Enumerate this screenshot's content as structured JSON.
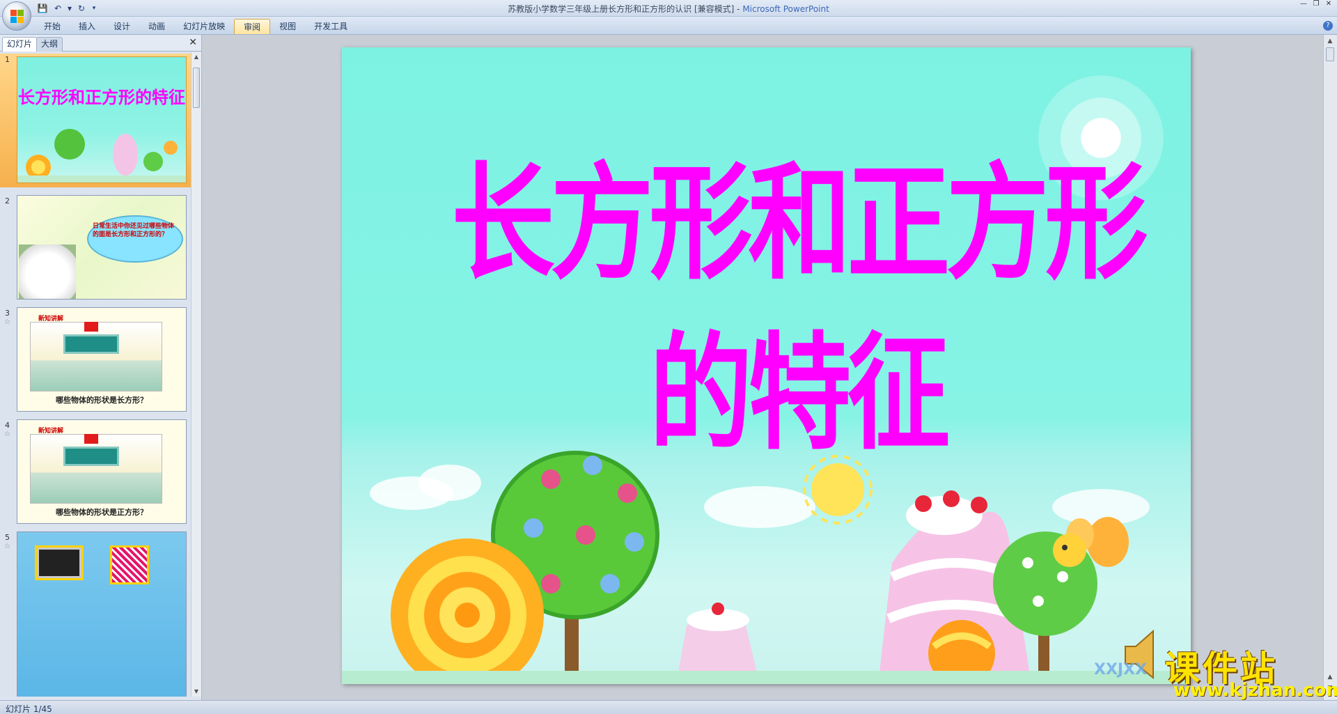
{
  "window": {
    "title": "苏教版小学数学三年级上册长方形和正方形的认识 [兼容模式]",
    "app_name": "Microsoft PowerPoint",
    "title_separator": " - "
  },
  "quick_access": {
    "icons": [
      "save-icon",
      "undo-icon",
      "dropdown-icon",
      "redo-icon",
      "customize-icon"
    ]
  },
  "ribbon": {
    "tabs": [
      {
        "label": "开始"
      },
      {
        "label": "插入"
      },
      {
        "label": "设计"
      },
      {
        "label": "动画"
      },
      {
        "label": "幻灯片放映"
      },
      {
        "label": "审阅",
        "active": true
      },
      {
        "label": "视图"
      },
      {
        "label": "开发工具"
      }
    ]
  },
  "left_pane": {
    "tabs": [
      {
        "label": "幻灯片"
      },
      {
        "label": "大纲"
      }
    ],
    "slides": [
      {
        "number": "1",
        "title": "长方形和正方形的特征",
        "selected": true
      },
      {
        "number": "2",
        "text": "日常生活中你还见过哪些物体的面是长方形和正方形的？"
      },
      {
        "number": "3",
        "label": "新知讲解",
        "question": "哪些物体的形状是长方形？"
      },
      {
        "number": "4",
        "label": "新知讲解",
        "question": "哪些物体的形状是正方形？"
      },
      {
        "number": "5"
      }
    ]
  },
  "slide": {
    "title": "长方形和正方形的特征",
    "watermark": "XXJXX",
    "colors": {
      "title": "#ff00ff",
      "background": "#7df2e3"
    }
  },
  "branding": {
    "name": "课件站",
    "url": "www.kjzhan.com"
  },
  "status": {
    "slide_counter": "幻灯片 1/45"
  }
}
